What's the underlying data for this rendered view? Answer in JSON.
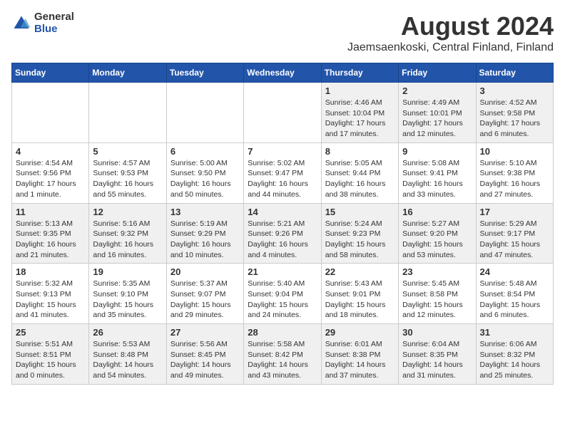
{
  "logo": {
    "general": "General",
    "blue": "Blue"
  },
  "title": "August 2024",
  "location": "Jaemsaenkoski, Central Finland, Finland",
  "weekdays": [
    "Sunday",
    "Monday",
    "Tuesday",
    "Wednesday",
    "Thursday",
    "Friday",
    "Saturday"
  ],
  "weeks": [
    [
      {
        "day": "",
        "info": ""
      },
      {
        "day": "",
        "info": ""
      },
      {
        "day": "",
        "info": ""
      },
      {
        "day": "",
        "info": ""
      },
      {
        "day": "1",
        "info": "Sunrise: 4:46 AM\nSunset: 10:04 PM\nDaylight: 17 hours\nand 17 minutes."
      },
      {
        "day": "2",
        "info": "Sunrise: 4:49 AM\nSunset: 10:01 PM\nDaylight: 17 hours\nand 12 minutes."
      },
      {
        "day": "3",
        "info": "Sunrise: 4:52 AM\nSunset: 9:58 PM\nDaylight: 17 hours\nand 6 minutes."
      }
    ],
    [
      {
        "day": "4",
        "info": "Sunrise: 4:54 AM\nSunset: 9:56 PM\nDaylight: 17 hours\nand 1 minute."
      },
      {
        "day": "5",
        "info": "Sunrise: 4:57 AM\nSunset: 9:53 PM\nDaylight: 16 hours\nand 55 minutes."
      },
      {
        "day": "6",
        "info": "Sunrise: 5:00 AM\nSunset: 9:50 PM\nDaylight: 16 hours\nand 50 minutes."
      },
      {
        "day": "7",
        "info": "Sunrise: 5:02 AM\nSunset: 9:47 PM\nDaylight: 16 hours\nand 44 minutes."
      },
      {
        "day": "8",
        "info": "Sunrise: 5:05 AM\nSunset: 9:44 PM\nDaylight: 16 hours\nand 38 minutes."
      },
      {
        "day": "9",
        "info": "Sunrise: 5:08 AM\nSunset: 9:41 PM\nDaylight: 16 hours\nand 33 minutes."
      },
      {
        "day": "10",
        "info": "Sunrise: 5:10 AM\nSunset: 9:38 PM\nDaylight: 16 hours\nand 27 minutes."
      }
    ],
    [
      {
        "day": "11",
        "info": "Sunrise: 5:13 AM\nSunset: 9:35 PM\nDaylight: 16 hours\nand 21 minutes."
      },
      {
        "day": "12",
        "info": "Sunrise: 5:16 AM\nSunset: 9:32 PM\nDaylight: 16 hours\nand 16 minutes."
      },
      {
        "day": "13",
        "info": "Sunrise: 5:19 AM\nSunset: 9:29 PM\nDaylight: 16 hours\nand 10 minutes."
      },
      {
        "day": "14",
        "info": "Sunrise: 5:21 AM\nSunset: 9:26 PM\nDaylight: 16 hours\nand 4 minutes."
      },
      {
        "day": "15",
        "info": "Sunrise: 5:24 AM\nSunset: 9:23 PM\nDaylight: 15 hours\nand 58 minutes."
      },
      {
        "day": "16",
        "info": "Sunrise: 5:27 AM\nSunset: 9:20 PM\nDaylight: 15 hours\nand 53 minutes."
      },
      {
        "day": "17",
        "info": "Sunrise: 5:29 AM\nSunset: 9:17 PM\nDaylight: 15 hours\nand 47 minutes."
      }
    ],
    [
      {
        "day": "18",
        "info": "Sunrise: 5:32 AM\nSunset: 9:13 PM\nDaylight: 15 hours\nand 41 minutes."
      },
      {
        "day": "19",
        "info": "Sunrise: 5:35 AM\nSunset: 9:10 PM\nDaylight: 15 hours\nand 35 minutes."
      },
      {
        "day": "20",
        "info": "Sunrise: 5:37 AM\nSunset: 9:07 PM\nDaylight: 15 hours\nand 29 minutes."
      },
      {
        "day": "21",
        "info": "Sunrise: 5:40 AM\nSunset: 9:04 PM\nDaylight: 15 hours\nand 24 minutes."
      },
      {
        "day": "22",
        "info": "Sunrise: 5:43 AM\nSunset: 9:01 PM\nDaylight: 15 hours\nand 18 minutes."
      },
      {
        "day": "23",
        "info": "Sunrise: 5:45 AM\nSunset: 8:58 PM\nDaylight: 15 hours\nand 12 minutes."
      },
      {
        "day": "24",
        "info": "Sunrise: 5:48 AM\nSunset: 8:54 PM\nDaylight: 15 hours\nand 6 minutes."
      }
    ],
    [
      {
        "day": "25",
        "info": "Sunrise: 5:51 AM\nSunset: 8:51 PM\nDaylight: 15 hours\nand 0 minutes."
      },
      {
        "day": "26",
        "info": "Sunrise: 5:53 AM\nSunset: 8:48 PM\nDaylight: 14 hours\nand 54 minutes."
      },
      {
        "day": "27",
        "info": "Sunrise: 5:56 AM\nSunset: 8:45 PM\nDaylight: 14 hours\nand 49 minutes."
      },
      {
        "day": "28",
        "info": "Sunrise: 5:58 AM\nSunset: 8:42 PM\nDaylight: 14 hours\nand 43 minutes."
      },
      {
        "day": "29",
        "info": "Sunrise: 6:01 AM\nSunset: 8:38 PM\nDaylight: 14 hours\nand 37 minutes."
      },
      {
        "day": "30",
        "info": "Sunrise: 6:04 AM\nSunset: 8:35 PM\nDaylight: 14 hours\nand 31 minutes."
      },
      {
        "day": "31",
        "info": "Sunrise: 6:06 AM\nSunset: 8:32 PM\nDaylight: 14 hours\nand 25 minutes."
      }
    ]
  ]
}
